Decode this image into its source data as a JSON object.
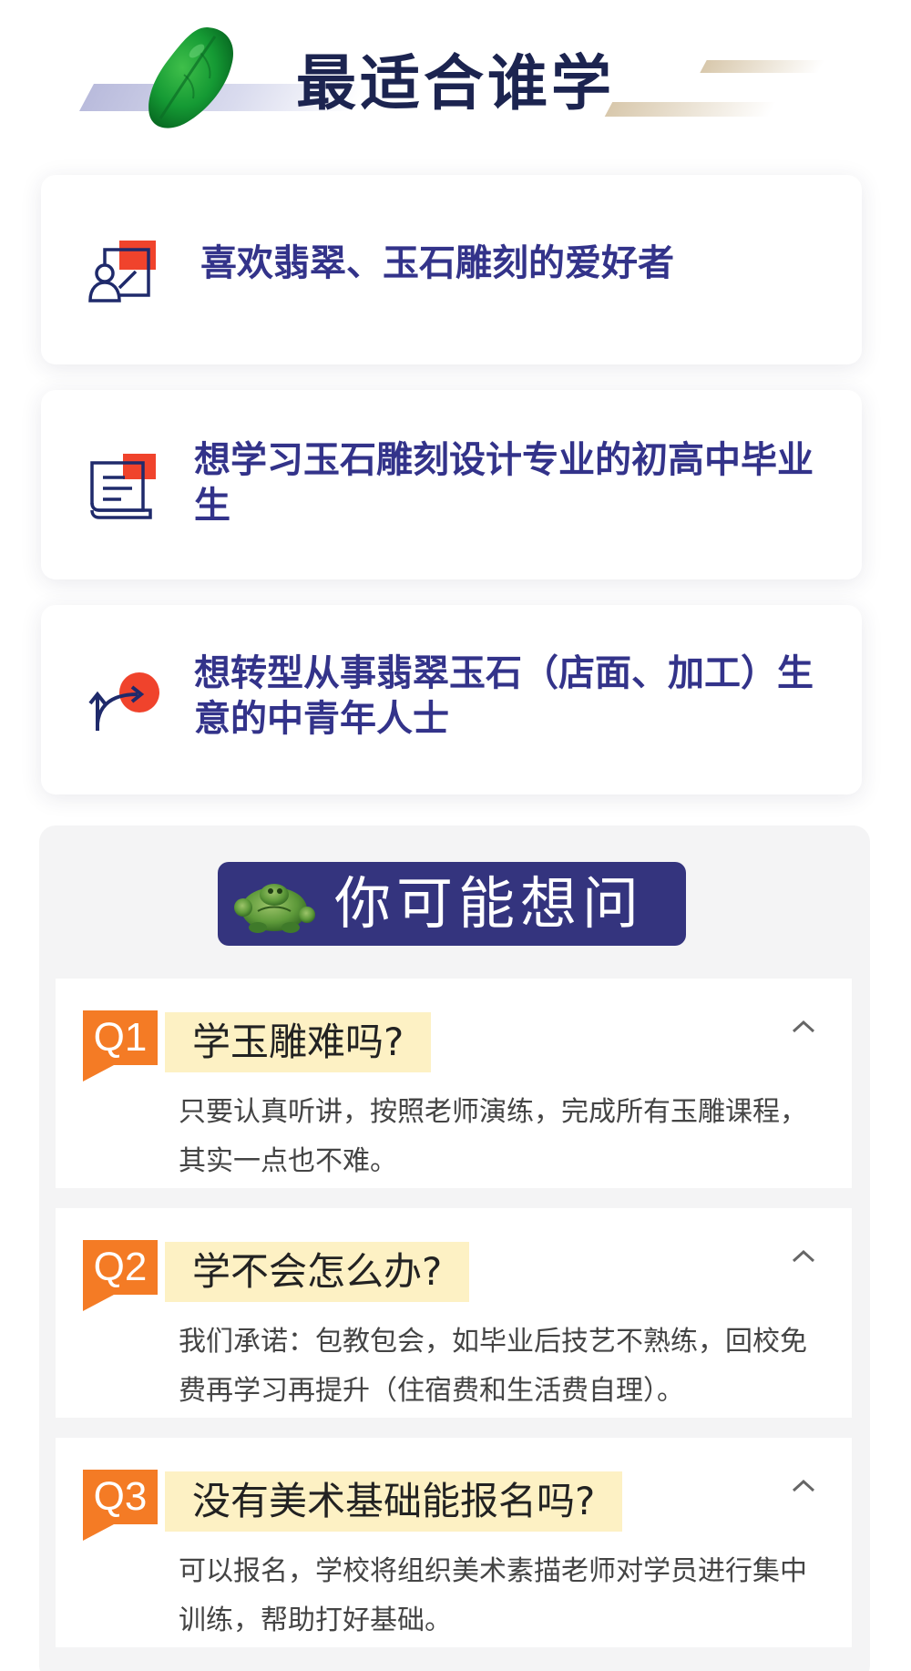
{
  "header": {
    "title": "最适合谁学",
    "leaf_icon": "jade-leaf-icon"
  },
  "audience": {
    "items": [
      {
        "icon": "presenter-icon",
        "text": "喜欢翡翠、玉石雕刻的爱好者"
      },
      {
        "icon": "book-icon",
        "text": "想学习玉石雕刻设计专业的初高中毕业生"
      },
      {
        "icon": "turn-arrow-icon",
        "text": "想转型从事翡翠玉石（店面、加工）生意的中青年人士"
      }
    ]
  },
  "faq": {
    "banner_label": "你可能想问",
    "banner_icon": "jade-turtle-icon",
    "items": [
      {
        "badge": "Q1",
        "question": "学玉雕难吗?",
        "answer": "只要认真听讲，按照老师演练，完成所有玉雕课程，其实一点也不难。"
      },
      {
        "badge": "Q2",
        "question": "学不会怎么办?",
        "answer": "我们承诺：包教包会，如毕业后技艺不熟练，回校免费再学习再提升（住宿费和生活费自理）。"
      },
      {
        "badge": "Q3",
        "question": "没有美术基础能报名吗?",
        "answer": "可以报名，学校将组织美术素描老师对学员进行集中训练，帮助打好基础。"
      }
    ]
  },
  "colors": {
    "accent_navy": "#34347e",
    "text_navy": "#33338a",
    "badge_orange": "#f47b25",
    "icon_red": "#f0432c",
    "question_highlight": "#fdf1c4"
  }
}
